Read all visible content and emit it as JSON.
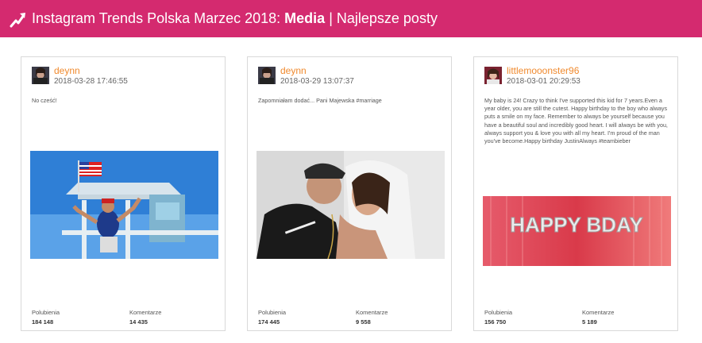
{
  "header": {
    "title_prefix": "Instagram Trends Polska Marzec 2018:",
    "title_bold": "Media",
    "title_suffix": "| Najlepsze posty"
  },
  "colors": {
    "accent": "#d42a6f",
    "username": "#f08a2e"
  },
  "stats_labels": {
    "likes": "Polubienia",
    "comments": "Komentarze"
  },
  "posts": [
    {
      "username": "deynn",
      "date": "2018-03-28 17:46:55",
      "caption": "No cześć!",
      "likes": "184 148",
      "comments": "14 435"
    },
    {
      "username": "deynn",
      "date": "2018-03-29 13:07:37",
      "caption": "Zapomniałam dodać... Pani Majewska #marriage",
      "likes": "174 445",
      "comments": "9 558"
    },
    {
      "username": "littlemooonster96",
      "date": "2018-03-01 20:29:53",
      "caption": "My baby is 24! Crazy to think I've supported this kid for 7 years.Even a year older, you are still the cutest. Happy birthday to the boy who always puts a smile on my face. Remember to always be yourself because you have a beautiful soul and incredibly good heart. I will always be with you, always support you & love you with all my heart. I'm proud of the man you've become.Happy birthday JustinAlways #teambieber",
      "likes": "156 750",
      "comments": "5 189",
      "photo_text": "HAPPY BDAY"
    }
  ]
}
